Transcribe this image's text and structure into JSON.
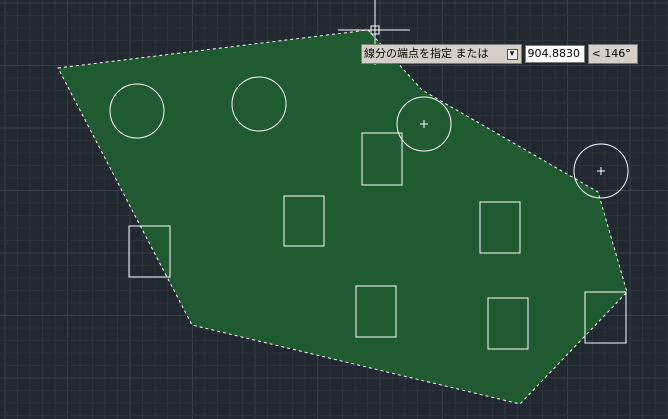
{
  "colors": {
    "background": "#212830",
    "grid_minor": "#2b323b",
    "grid_major": "#38404a",
    "hatch_fill": "#1f5a30",
    "outline": "#ffffff",
    "tooltip_bg": "#d4d0c8"
  },
  "dynamic_input": {
    "prompt": "線分の端点を指定 または",
    "options_icon": "down-arrow-icon",
    "length_value": "904.8830",
    "angle_value": "< 146°"
  }
}
